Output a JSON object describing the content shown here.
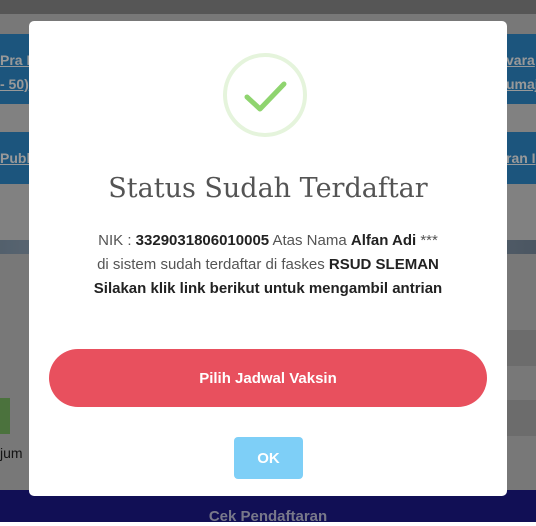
{
  "background": {
    "link_left_top": "Pra L",
    "link_left_mid": "- 50)",
    "link_right_top": "vara",
    "link_right_mid": "umaja",
    "link_left_second": "Publi",
    "link_right_second": "ran I",
    "side_text": "jum",
    "bottom_button": "Cek Pendaftaran"
  },
  "modal": {
    "icon": "success-check-icon",
    "title": "Status Sudah Terdaftar",
    "line1_prefix": "NIK :",
    "nik": "3329031806010005",
    "line1_mid": "Atas Nama",
    "name": "Alfan Adi",
    "line1_suffix": "***",
    "line2_prefix": "di sistem sudah terdaftar di faskes",
    "faskes": "RSUD SLEMAN",
    "line3": "Silakan klik link berikut untuk mengambil antrian",
    "primary_button": "Pilih Jadwal Vaksin",
    "ok_button": "OK"
  },
  "colors": {
    "success": "#8fd46f",
    "primary_button": "#e8505e",
    "ok_button": "#7ecff7",
    "header_blue": "#2f8ed0",
    "bottom_bar": "#1d1a8e"
  }
}
